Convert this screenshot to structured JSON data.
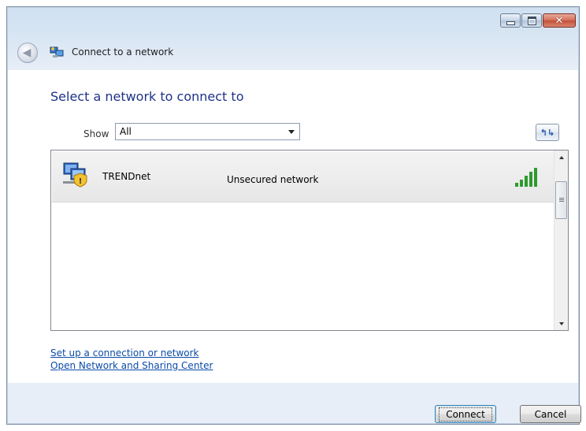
{
  "window": {
    "title": "Connect to a network",
    "caption_buttons": [
      "minimize",
      "maximize",
      "close"
    ]
  },
  "main": {
    "heading": "Select a network to connect to",
    "show_label": "Show",
    "show_value": "All"
  },
  "networks": [
    {
      "name": "TRENDnet",
      "security": "Unsecured network",
      "icon": "unsecured-network-icon",
      "signal_bars": 5,
      "selected": true
    }
  ],
  "links": {
    "setup": "Set up a connection or network",
    "sharing_center": "Open Network and Sharing Center"
  },
  "footer": {
    "connect_label": "Connect",
    "cancel_label": "Cancel"
  },
  "colors": {
    "heading": "#1e3287",
    "link": "#0b4ba8",
    "signal": "#2e9a2e"
  }
}
